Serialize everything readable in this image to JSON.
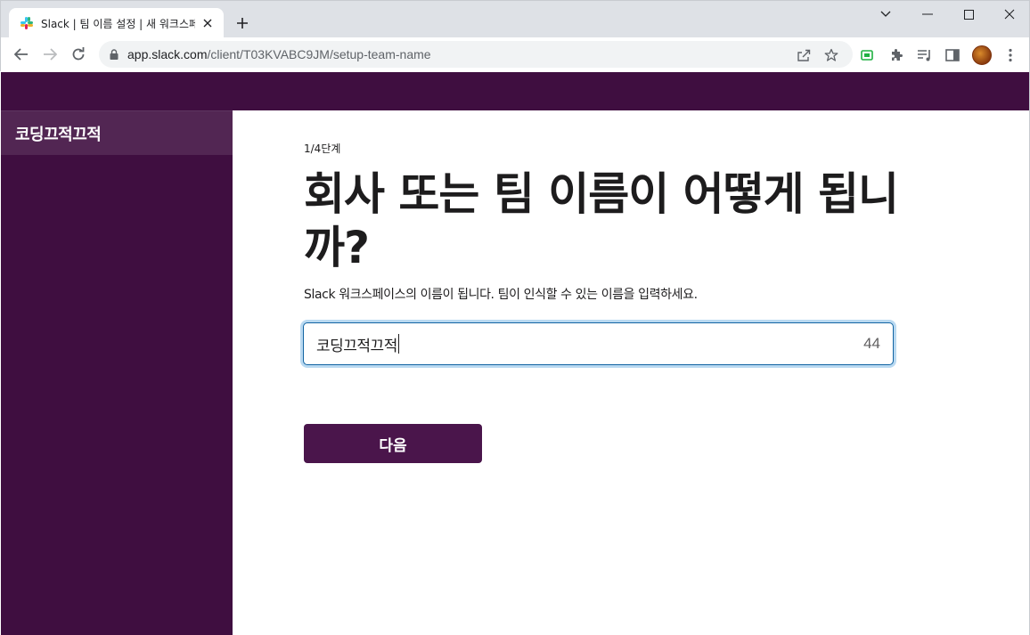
{
  "browser": {
    "tab_title": "Slack | 팀 이름 설정 | 새 워크스페이스",
    "url_host": "app.slack.com",
    "url_path": "/client/T03KVABC9JM/setup-team-name"
  },
  "sidebar": {
    "workspace_name": "코딩끄적끄적"
  },
  "setup": {
    "step": "1/4단계",
    "heading": "회사 또는 팀 이름이 어떻게 됩니까?",
    "description": "Slack 워크스페이스의 이름이 됩니다. 팀이 인식할 수 있는 이름을 입력하세요.",
    "input_value": "코딩끄적끄적",
    "char_counter": "44",
    "next_label": "다음"
  },
  "colors": {
    "slack_aubergine": "#3f0e40",
    "sidebar_header": "#522653",
    "button": "#4a154b",
    "focus_blue": "#1264a3"
  }
}
